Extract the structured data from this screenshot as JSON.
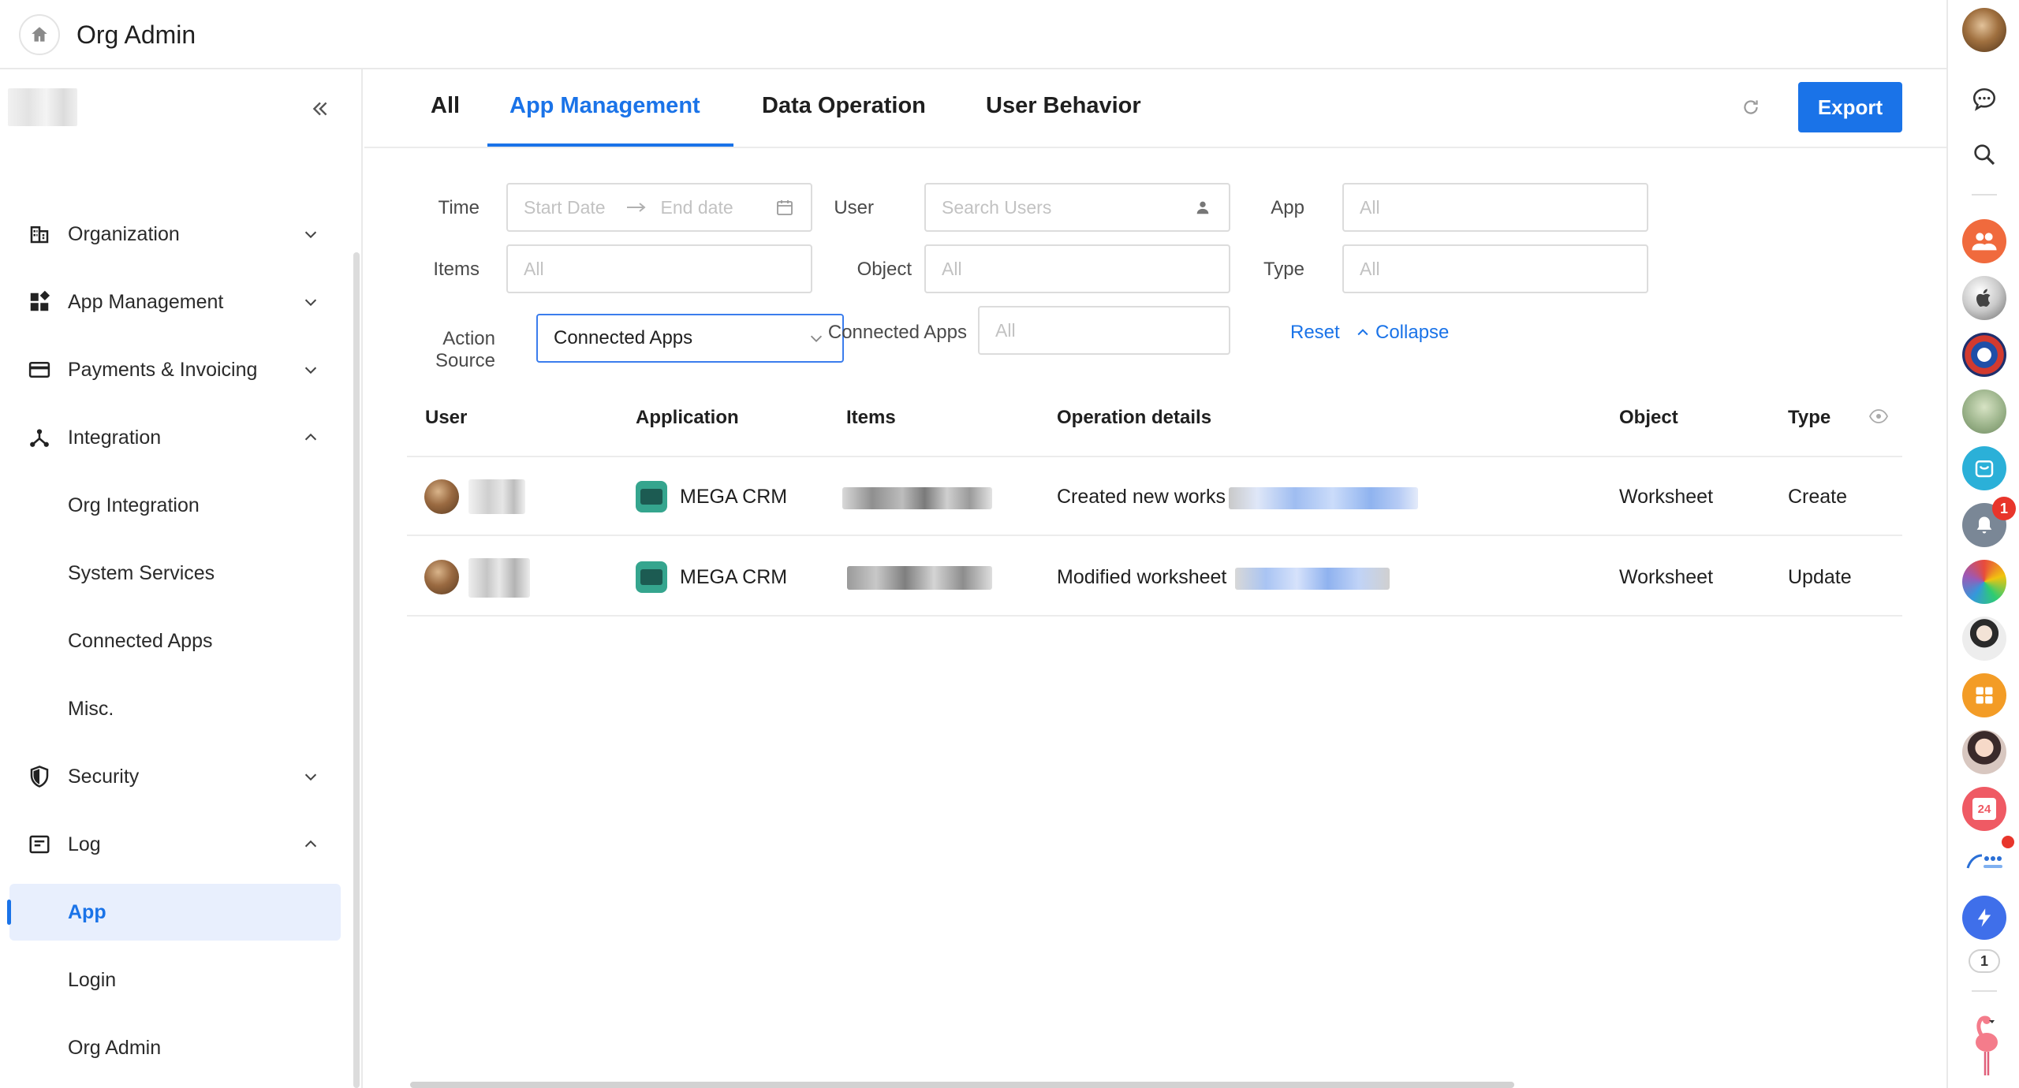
{
  "header": {
    "title": "Org Admin"
  },
  "sidebar": {
    "items": [
      {
        "label": "Organization",
        "icon": "building-icon",
        "expanded": false
      },
      {
        "label": "App Management",
        "icon": "apps-grid-icon",
        "expanded": false
      },
      {
        "label": "Payments & Invoicing",
        "icon": "credit-card-icon",
        "expanded": false
      },
      {
        "label": "Integration",
        "icon": "integration-icon",
        "expanded": true,
        "children": [
          "Org Integration",
          "System Services",
          "Connected Apps",
          "Misc."
        ]
      },
      {
        "label": "Security",
        "icon": "shield-icon",
        "expanded": false
      },
      {
        "label": "Log",
        "icon": "log-icon",
        "expanded": true,
        "children": [
          "App",
          "Login",
          "Org Admin"
        ],
        "active_child": "App"
      }
    ]
  },
  "tabs": {
    "items": [
      "All",
      "App Management",
      "Data Operation",
      "User Behavior"
    ],
    "active": "App Management"
  },
  "toolbar": {
    "export_label": "Export"
  },
  "filters": {
    "time_label": "Time",
    "start_placeholder": "Start Date",
    "end_placeholder": "End date",
    "user_label": "User",
    "user_placeholder": "Search Users",
    "app_label": "App",
    "app_placeholder": "All",
    "items_label": "Items",
    "items_placeholder": "All",
    "object_label": "Object",
    "object_placeholder": "All",
    "type_label": "Type",
    "type_placeholder": "All",
    "action_source_label": "Action Source",
    "action_source_value": "Connected Apps",
    "connected_apps_label": "Connected Apps",
    "connected_apps_placeholder": "All",
    "reset_label": "Reset",
    "collapse_label": "Collapse"
  },
  "table": {
    "columns": [
      "User",
      "Application",
      "Items",
      "Operation details",
      "Object",
      "Type"
    ],
    "rows": [
      {
        "application": "MEGA CRM",
        "operation": "Created new works",
        "object": "Worksheet",
        "type": "Create"
      },
      {
        "application": "MEGA CRM",
        "operation": "Modified worksheet",
        "object": "Worksheet",
        "type": "Update"
      }
    ]
  },
  "dock": {
    "notification_badge": "1",
    "pill_count": "1",
    "calendar_day": "24",
    "colors": {
      "accent": "#1a73e8"
    }
  }
}
